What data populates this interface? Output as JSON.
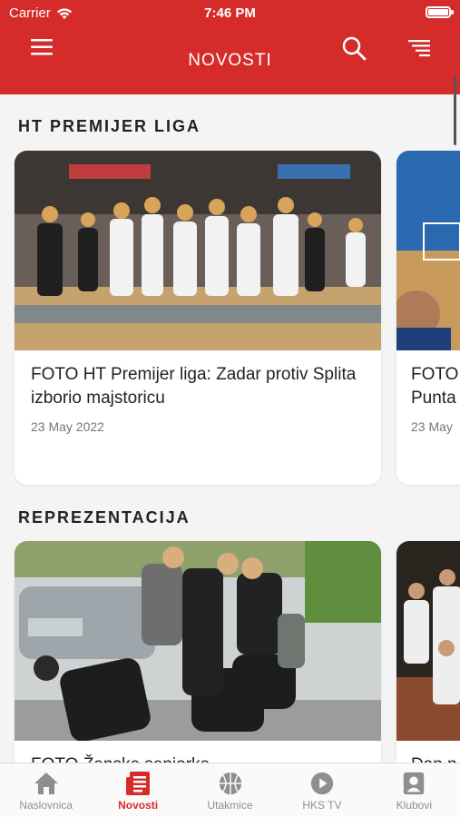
{
  "status_bar": {
    "carrier": "Carrier",
    "time": "7:46 PM",
    "battery_level": 1.0
  },
  "header": {
    "title": "NOVOSTI",
    "icons": [
      "hamburger-menu-icon",
      "search-icon",
      "filter-list-icon"
    ]
  },
  "colors": {
    "brand_red": "#d52b2b",
    "background": "#f4f4f4",
    "tab_inactive": "#8e8e8e"
  },
  "sections": [
    {
      "title": "HT PREMIJER LIGA",
      "cards": [
        {
          "title": "FOTO HT Premijer liga: Zadar protiv Splita izborio majstoricu",
          "date": "23 May 2022"
        },
        {
          "title": "FOTO Punta",
          "date": "23 May"
        }
      ]
    },
    {
      "title": "REPREZENTACIJA",
      "cards": [
        {
          "title": "FOTO Ženske seniorke"
        },
        {
          "title": "Dan p"
        }
      ]
    }
  ],
  "tabbar": {
    "items": [
      {
        "label": "Naslovnica",
        "icon": "home-icon",
        "active": false
      },
      {
        "label": "Novosti",
        "icon": "news-icon",
        "active": true
      },
      {
        "label": "Utakmice",
        "icon": "basketball-icon",
        "active": false
      },
      {
        "label": "HKS TV",
        "icon": "play-icon",
        "active": false
      },
      {
        "label": "Klubovi",
        "icon": "club-badge-icon",
        "active": false
      }
    ]
  }
}
